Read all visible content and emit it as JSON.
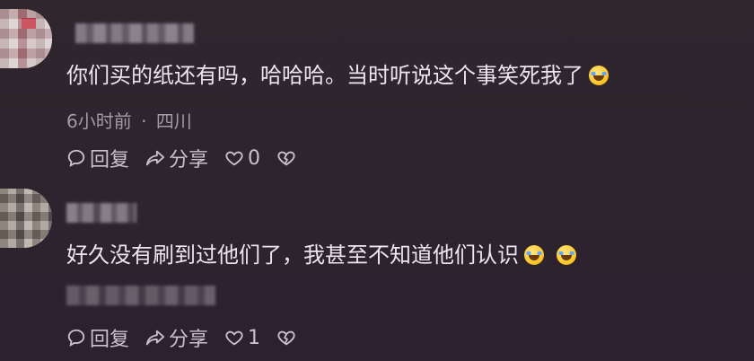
{
  "comments": [
    {
      "text": "你们买的纸还有吗，哈哈哈。当时听说这个事笑死我了",
      "emoji_count": 1,
      "time": "6小时前",
      "separator": "·",
      "location": "四川",
      "reply_label": "回复",
      "share_label": "分享",
      "like_count": "0"
    },
    {
      "text": "好久没有刷到过他们了，我甚至不知道他们认识",
      "emoji_count": 2,
      "reply_label": "回复",
      "share_label": "分享",
      "like_count": "1"
    }
  ],
  "icons": {
    "reply": "speech-bubble-icon",
    "share": "share-arrow-icon",
    "like": "heart-icon",
    "dislike": "broken-heart-icon",
    "emoji": "laughing-tears-emoji"
  }
}
